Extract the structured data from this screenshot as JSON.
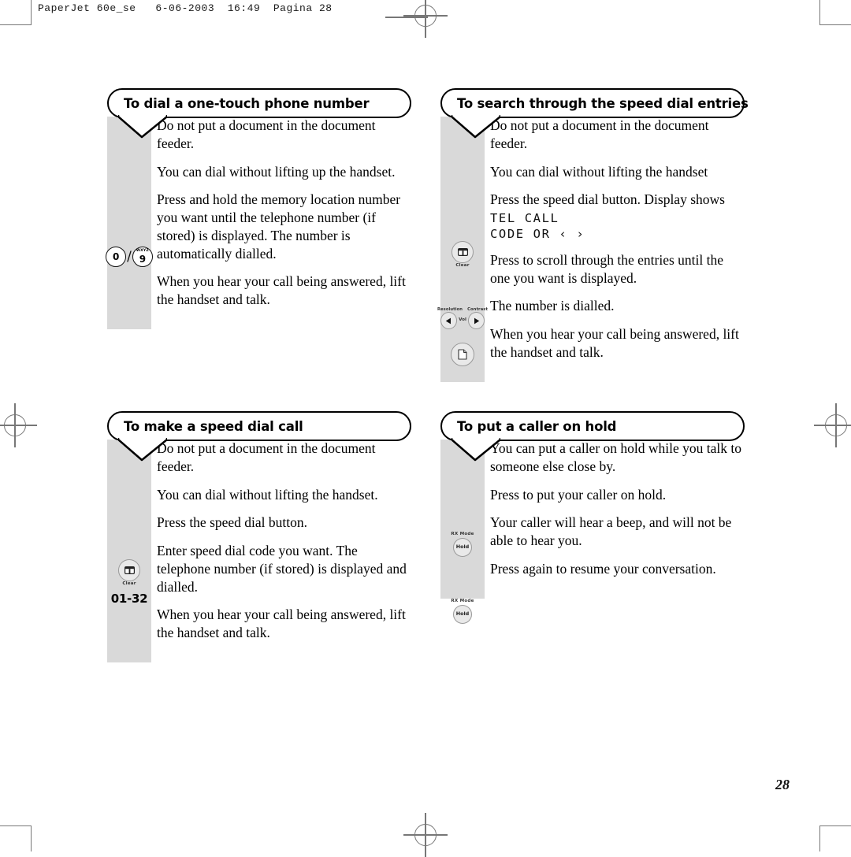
{
  "prepress": {
    "header": "PaperJet 60e_se   6-06-2003  16:49  Pagina 28"
  },
  "page": {
    "number": "28"
  },
  "sections": [
    {
      "id": "dial-one-touch",
      "title": "To dial a one-touch phone number",
      "paragraphs": [
        "Do not put a document in the document feeder.",
        "You can dial without lifting up the handset.",
        "Press and hold the memory location number you want until the telephone number (if stored) is displayed. The number is automatically dialled.",
        "When you hear your call being answered, lift the handset and talk."
      ],
      "icons": [
        {
          "type": "number-keys",
          "keys": [
            "0",
            "9"
          ],
          "key_superscript": "WXYZ",
          "separator": "/"
        }
      ]
    },
    {
      "id": "search-speed-dial",
      "title": "To search through the speed dial entries",
      "paragraphs": [
        "Do not put a document in the document feeder.",
        "You can dial without lifting the handset",
        "Press the speed dial button. Display shows",
        "Press to scroll through the entries until the one you want is displayed.",
        "The number is dialled.",
        "When you hear your call being answered, lift the handset and talk."
      ],
      "display_lines": [
        "TEL CALL",
        "CODE OR ‹ ›"
      ],
      "icons": [
        {
          "type": "speed-dial-button",
          "caption": "Clear"
        },
        {
          "type": "scroll-arrows",
          "left_label": "Resolution",
          "right_label": "Contrast",
          "middle_label": "Vol"
        },
        {
          "type": "page-button"
        }
      ]
    },
    {
      "id": "make-speed-dial-call",
      "title": "To make a speed dial call",
      "paragraphs": [
        "Do not put a document in the document feeder.",
        "You can dial without lifting the handset.",
        "Press the speed dial button.",
        "Enter speed dial code you want. The telephone number (if stored) is displayed and dialled.",
        "When you hear your call being answered, lift the handset and talk."
      ],
      "icons": [
        {
          "type": "speed-dial-button",
          "caption": "Clear"
        },
        {
          "type": "range-label",
          "text": "01-32"
        }
      ]
    },
    {
      "id": "put-caller-on-hold",
      "title": "To put a caller on hold",
      "paragraphs": [
        "You can put a caller on hold while you talk to someone else close by.",
        "Press to put your caller on hold.",
        "Your caller will hear a beep, and will not be able to hear you.",
        "Press again to resume your conversation."
      ],
      "icons": [
        {
          "type": "hold-button",
          "top_label": "RX Mode",
          "inner_label": "Hold"
        },
        {
          "type": "hold-button",
          "top_label": "RX Mode",
          "inner_label": "Hold"
        }
      ]
    }
  ],
  "colors": {
    "gutter": "#d9d9d9",
    "outline": "#000000",
    "mark": "#777777"
  }
}
